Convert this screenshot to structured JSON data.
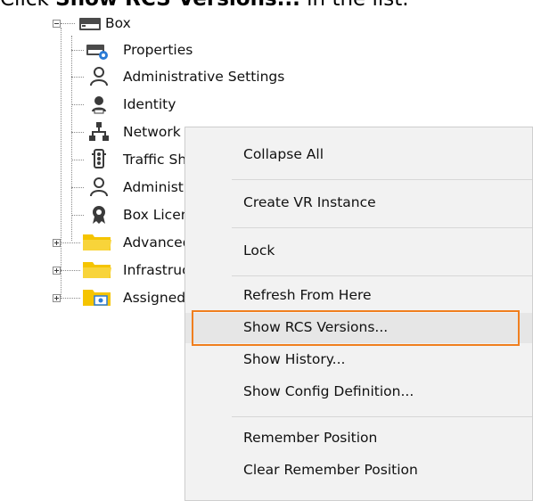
{
  "instruction": {
    "prefix": "Click ",
    "bold": "Show RCS Versions...",
    "suffix": " in the list."
  },
  "tree": {
    "root": {
      "label": "Box",
      "icon": "box-icon"
    },
    "children": [
      {
        "label": "Properties",
        "icon": "properties-icon"
      },
      {
        "label": "Administrative Settings",
        "icon": "admin-user-icon"
      },
      {
        "label": "Identity",
        "icon": "identity-icon"
      },
      {
        "label": "Network",
        "icon": "network-icon"
      },
      {
        "label": "Traffic Shaping",
        "icon": "traffic-light-icon"
      },
      {
        "label": "Administrators",
        "icon": "admin-user-icon"
      },
      {
        "label": "Box Licenses",
        "icon": "license-icon"
      },
      {
        "label": "Advanced Configuration",
        "icon": "folder-icon"
      },
      {
        "label": "Infrastructure Services",
        "icon": "folder-icon"
      },
      {
        "label": "Assigned Services",
        "icon": "services-folder-icon"
      }
    ],
    "colors": {
      "folder": "#f5c400",
      "icon_dark": "#3a3a3a",
      "gear_blue": "#2b7bd6"
    }
  },
  "context_menu": {
    "items": [
      "Collapse All",
      "Create VR Instance",
      "Lock",
      "Refresh From Here",
      "Show RCS Versions...",
      "Show History...",
      "Show Config Definition...",
      "Remember Position",
      "Clear Remember Position"
    ],
    "highlighted_index": 4,
    "highlight_color": "#f07f1f"
  }
}
